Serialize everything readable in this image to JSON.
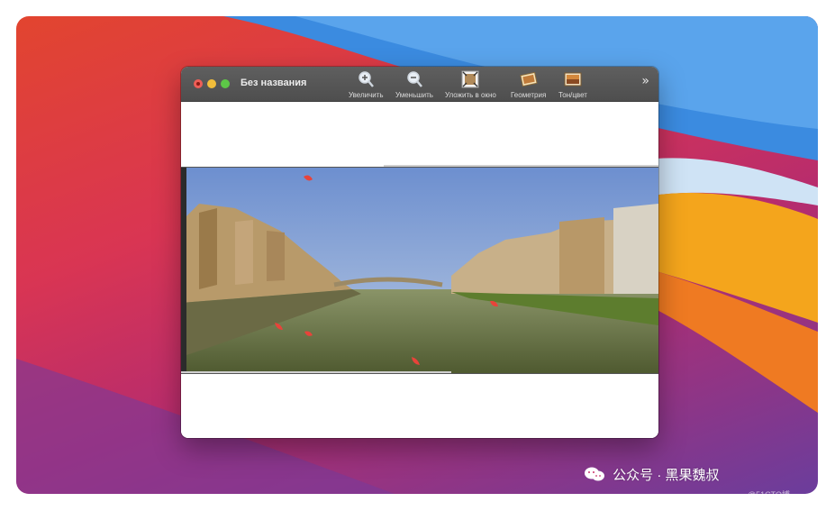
{
  "window": {
    "title": "Без названия"
  },
  "toolbar": {
    "zoom_in": "Увеличить",
    "zoom_out": "Уменьшить",
    "fit": "Уложить в окно",
    "geometry": "Геометрия",
    "tone": "Тон/цвет",
    "overflow": "»"
  },
  "watermark": {
    "text": "公众号 · 黑果魏叔",
    "badge": "@51CTO博"
  },
  "colors": {
    "titlebar": "#555555",
    "close": "#ee5e57",
    "minimize": "#f2bd3a",
    "maximize": "#5dc747",
    "wallpaper_blue": "#2f7fd6",
    "wallpaper_orange": "#f4a51c"
  },
  "icons": [
    "zoom-in-icon",
    "zoom-out-icon",
    "fit-window-icon",
    "geometry-icon",
    "tone-color-icon",
    "wechat-icon"
  ]
}
